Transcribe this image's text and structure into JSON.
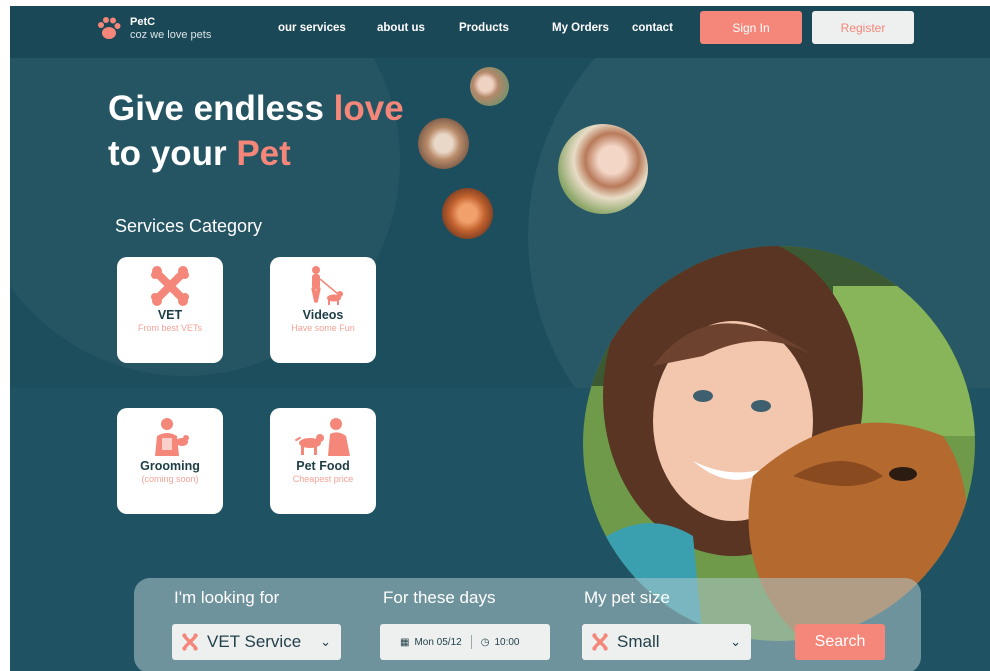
{
  "brand": {
    "name": "PetC",
    "tagline": "coz we love pets"
  },
  "nav": {
    "links": [
      "our services",
      "about us",
      "Products",
      "My Orders",
      "contact"
    ],
    "signin": "Sign In",
    "register": "Register"
  },
  "hero": {
    "line1": "Give endless ",
    "line1_accent": "love",
    "line2": "to your ",
    "line2_accent": "Pet"
  },
  "categories": {
    "title": "Services Category",
    "items": [
      {
        "title": "VET",
        "subtitle": "From best VETs",
        "icon": "bone-icon"
      },
      {
        "title": "Videos",
        "subtitle": "Have some Fun",
        "icon": "dog-walker-icon"
      },
      {
        "title": "Grooming",
        "subtitle": "(coming soon)",
        "icon": "groomer-icon"
      },
      {
        "title": "Pet Food",
        "subtitle": "Cheapest price",
        "icon": "feeding-dog-icon"
      }
    ]
  },
  "search": {
    "looking_label": "I'm looking for",
    "looking_value": "VET Service",
    "days_label": "For these days",
    "date": "Mon 05/12",
    "time": "10:00",
    "size_label": "My pet size",
    "size_value": "Small",
    "button": "Search"
  },
  "colors": {
    "background": "#1d4e5d",
    "accent": "#f4877a",
    "card": "#ffffff"
  }
}
